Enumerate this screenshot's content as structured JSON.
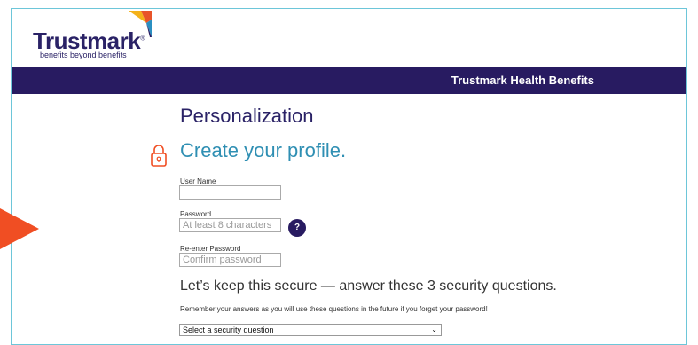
{
  "brand": {
    "name": "Trustmark",
    "trademark": "®",
    "tagline": "benefits beyond benefits"
  },
  "banner": {
    "title": "Trustmark Health Benefits"
  },
  "page": {
    "title": "Personalization",
    "section_title": "Create your profile."
  },
  "form": {
    "username": {
      "label": "User Name",
      "value": "",
      "placeholder": ""
    },
    "password": {
      "label": "Password",
      "value": "",
      "placeholder": "At least 8 characters",
      "help_label": "?"
    },
    "confirm_password": {
      "label": "Re-enter Password",
      "value": "",
      "placeholder": "Confirm password"
    }
  },
  "security": {
    "heading": "Let’s keep this secure — answer these 3 security questions.",
    "note": "Remember your answers as you will use these questions in the future if you forget your password!",
    "question_select": {
      "selected": "Select a security question"
    }
  },
  "icons": {
    "lock": "lock-icon",
    "help": "question-icon",
    "chevron": "chevron-down-icon",
    "pointer": "arrow-pointer-icon"
  },
  "colors": {
    "brand_navy": "#281b61",
    "accent_blue": "#2f8fb3",
    "frame_border": "#6dc6d9",
    "lock_orange": "#f04e23",
    "arrow_orange": "#f04e23"
  }
}
